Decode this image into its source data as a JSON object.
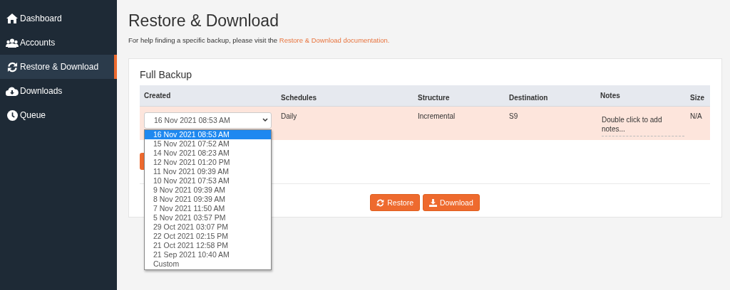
{
  "sidebar": {
    "items": [
      {
        "label": "Dashboard",
        "kind": "home",
        "selected": false
      },
      {
        "label": "Accounts",
        "kind": "users",
        "selected": false
      },
      {
        "label": "Restore & Download",
        "kind": "sync",
        "selected": true
      },
      {
        "label": "Downloads",
        "kind": "cloud",
        "selected": false
      },
      {
        "label": "Queue",
        "kind": "clock",
        "selected": false
      }
    ]
  },
  "page": {
    "title": "Restore & Download",
    "help_text": "For help finding a specific backup, please visit the ",
    "help_link": "Restore & Download documentation."
  },
  "backup": {
    "title": "Full Backup",
    "columns": [
      "Created",
      "Schedules",
      "Structure",
      "Destination",
      "Notes",
      "Size"
    ],
    "rows": [
      {
        "selected": true,
        "created": {
          "value": "16 Nov 2021 08:53 AM",
          "expanded": true,
          "options": [
            {
              "label": "16 Nov 2021 08:53 AM",
              "selected": true
            },
            {
              "label": "15 Nov 2021 07:52 AM",
              "selected": false
            },
            {
              "label": "14 Nov 2021 08:23 AM",
              "selected": false
            },
            {
              "label": "12 Nov 2021 01:20 PM",
              "selected": false
            },
            {
              "label": "11 Nov 2021 09:39 AM",
              "selected": false
            },
            {
              "label": "10 Nov 2021 07:53 AM",
              "selected": false
            },
            {
              "label": "9 Nov 2021 09:39 AM",
              "selected": false
            },
            {
              "label": "8 Nov 2021 09:39 AM",
              "selected": false
            },
            {
              "label": "7 Nov 2021 11:50 AM",
              "selected": false
            },
            {
              "label": "5 Nov 2021 03:57 PM",
              "selected": false
            },
            {
              "label": "29 Oct 2021 03:07 PM",
              "selected": false
            },
            {
              "label": "22 Oct 2021 02:15 PM",
              "selected": false
            },
            {
              "label": "21 Oct 2021 12:58 PM",
              "selected": false
            },
            {
              "label": "21 Sep 2021 10:40 AM",
              "selected": false
            },
            {
              "label": "Custom",
              "selected": false
            }
          ]
        },
        "schedules": "Daily",
        "structure": "Incremental",
        "destination": "S9",
        "notes_placeholder": "Double click to add notes...",
        "size": "N/A"
      }
    ]
  },
  "buttons": [
    {
      "label": "Restore",
      "kind": "restore"
    },
    {
      "label": "Download",
      "kind": "download"
    }
  ]
}
